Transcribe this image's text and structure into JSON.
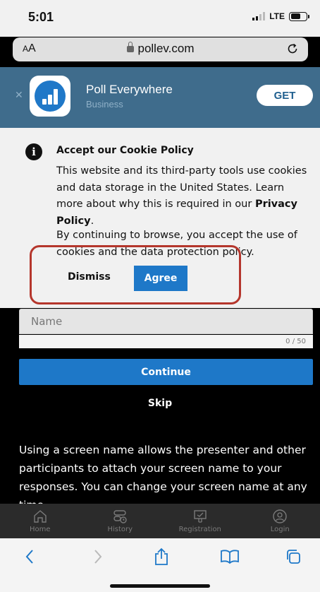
{
  "status_bar": {
    "time": "5:01",
    "network": "LTE"
  },
  "url_bar": {
    "text_size_label": "AA",
    "host": "pollev.com"
  },
  "app_banner": {
    "app_name": "Poll Everywhere",
    "category": "Business",
    "get_label": "GET"
  },
  "cookie_notice": {
    "title": "Accept our Cookie Policy",
    "body": "This website and its third-party tools use cookies and data storage in the United States. Learn more about why this is required in our",
    "privacy_link": "Privacy Policy",
    "body_suffix": ".",
    "continue_text": "By continuing to browse, you accept the use of cookies and the data protection policy.",
    "dismiss_label": "Dismiss",
    "agree_label": "Agree",
    "highlight_color": "#b5362c"
  },
  "form": {
    "name_placeholder": "Name",
    "name_value": "",
    "counter": "0 / 50",
    "continue_label": "Continue",
    "skip_label": "Skip",
    "explanation": "Using a screen name allows the presenter and other participants to attach your screen name to your responses. You can change your screen name at any time."
  },
  "tab_bar": {
    "items": [
      {
        "label": "Home",
        "icon": "home-icon"
      },
      {
        "label": "History",
        "icon": "history-icon"
      },
      {
        "label": "Registration",
        "icon": "registration-icon"
      },
      {
        "label": "Login",
        "icon": "login-icon"
      }
    ]
  },
  "colors": {
    "brand_blue": "#1e78c8",
    "banner_bg": "#3f6c8c",
    "tabbar_bg": "#2b2b2b"
  }
}
